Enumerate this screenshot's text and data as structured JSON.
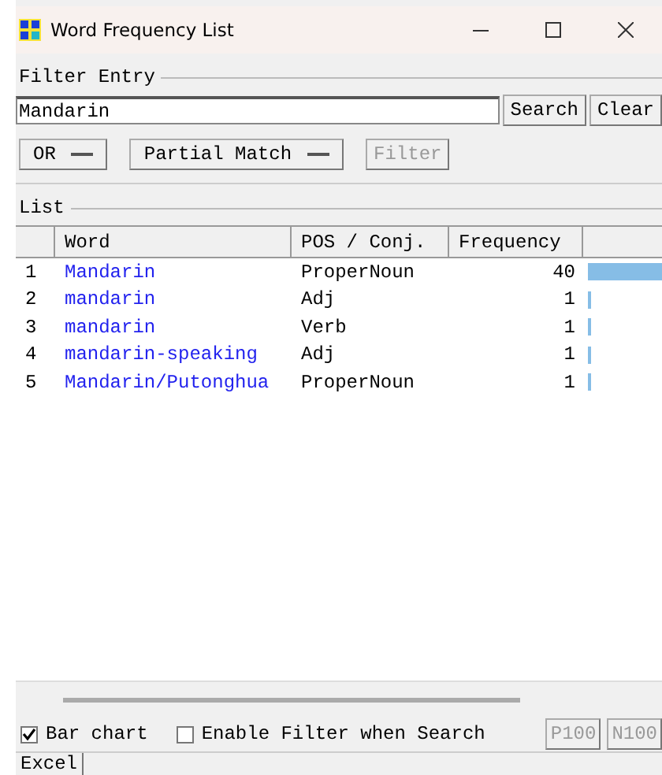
{
  "window": {
    "title": "Word Frequency List"
  },
  "filter_entry": {
    "label": "Filter Entry",
    "query": "Mandarin",
    "search_button": "Search",
    "clear_button": "Clear",
    "logic_dropdown": "OR",
    "match_dropdown": "Partial Match",
    "filter_button": {
      "label": "Filter",
      "disabled": true
    }
  },
  "list": {
    "label": "List",
    "columns": [
      "Word",
      "POS / Conj.",
      "Frequency"
    ],
    "rows": [
      {
        "index": "1",
        "word": "Mandarin",
        "pos": "ProperNoun",
        "frequency": "40"
      },
      {
        "index": "2",
        "word": "mandarin",
        "pos": "Adj",
        "frequency": "1"
      },
      {
        "index": "3",
        "word": "mandarin",
        "pos": "Verb",
        "frequency": "1"
      },
      {
        "index": "4",
        "word": "mandarin-speaking",
        "pos": "Adj",
        "frequency": "1"
      },
      {
        "index": "5",
        "word": "Mandarin/Putonghua",
        "pos": "ProperNoun",
        "frequency": "1"
      }
    ]
  },
  "options": [
    {
      "label": "Bar chart",
      "checked": true
    },
    {
      "label": "Enable Filter when Search",
      "checked": false
    }
  ],
  "page_buttons": [
    "P100",
    "N100"
  ],
  "bottom_tab": "Excel"
}
